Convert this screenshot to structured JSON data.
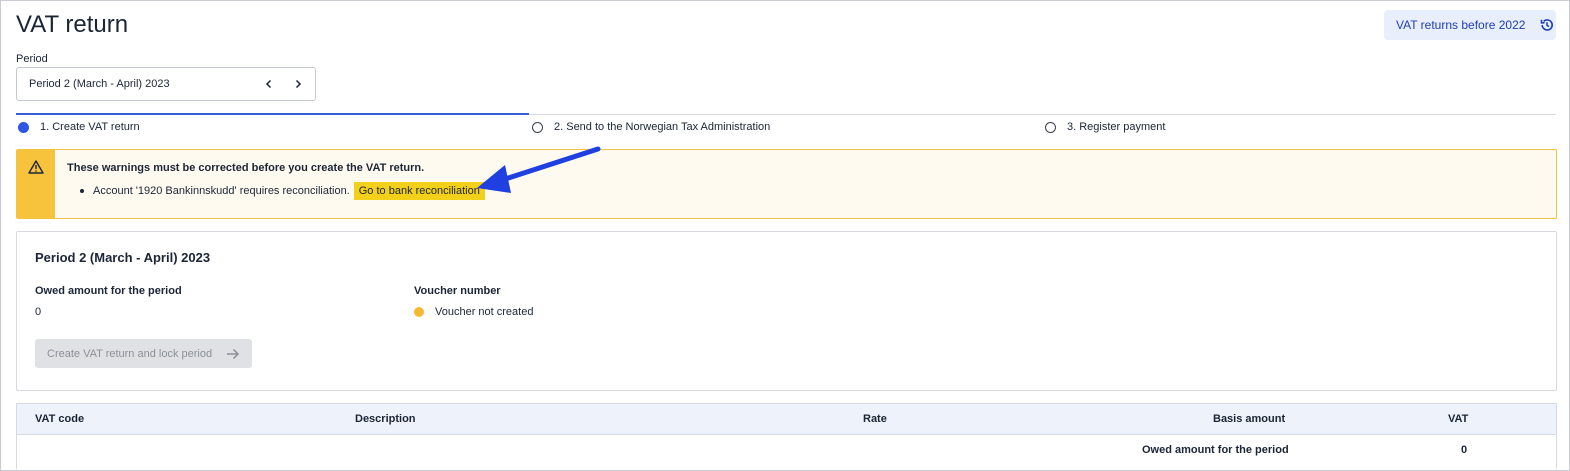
{
  "header": {
    "title": "VAT return",
    "history_button_label": "VAT returns before 2022",
    "history_icon": "history-icon"
  },
  "period": {
    "label": "Period",
    "selected": "Period 2 (March - April) 2023",
    "prev_icon": "chevron-left-icon",
    "next_icon": "chevron-right-icon"
  },
  "steps": [
    {
      "label": "1. Create VAT return",
      "active": true
    },
    {
      "label": "2. Send to the Norwegian Tax Administration",
      "active": false
    },
    {
      "label": "3. Register payment",
      "active": false
    }
  ],
  "warning": {
    "icon": "warning-icon",
    "title": "These warnings must be corrected before you create the VAT return.",
    "items": [
      {
        "text": "Account '1920 Bankinnskudd' requires reconciliation.",
        "link_label": "Go to bank reconciliation"
      }
    ],
    "colors": {
      "accent": "#f7c23c",
      "link_highlight": "#f3d11b",
      "annotation_arrow": "#1f3fe0"
    }
  },
  "summary": {
    "title": "Period 2 (March - April) 2023",
    "owed_label": "Owed amount for the period",
    "owed_value": "0",
    "voucher_label": "Voucher number",
    "voucher_status": "Voucher not created",
    "create_button_label": "Create VAT return and lock period"
  },
  "table": {
    "columns": [
      "VAT code",
      "Description",
      "Rate",
      "Basis amount",
      "VAT"
    ],
    "footer_label": "Owed amount for the period",
    "footer_value": "0"
  }
}
